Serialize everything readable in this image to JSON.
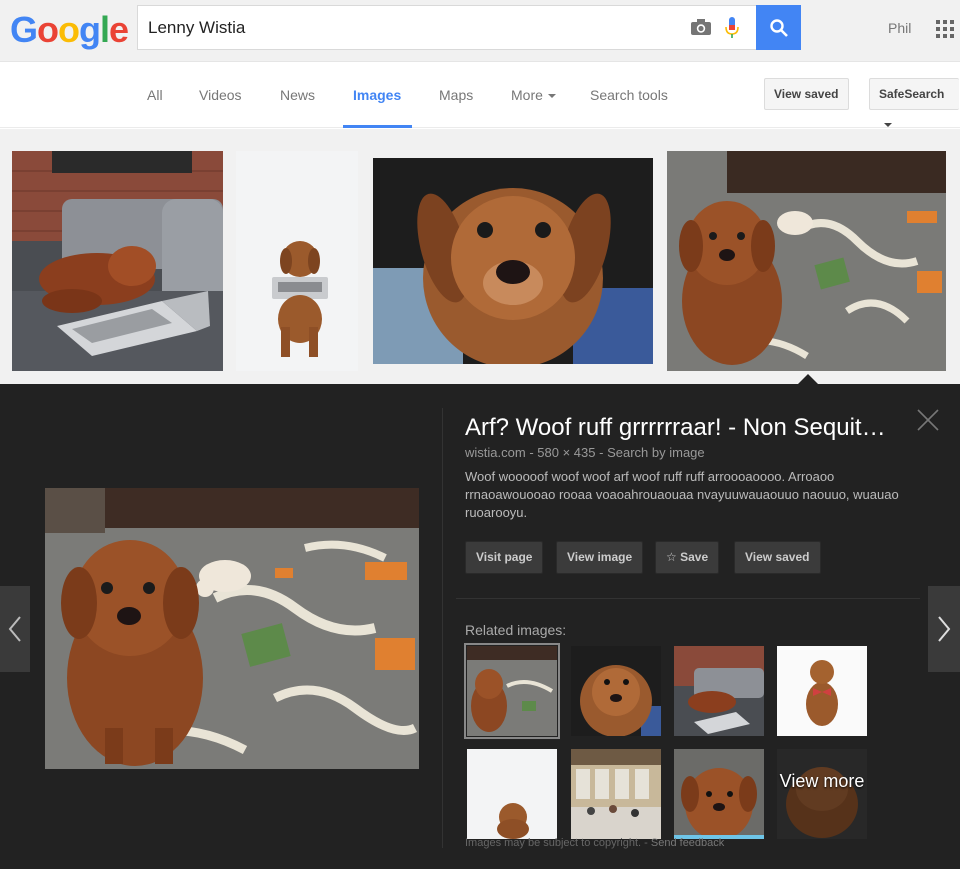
{
  "header": {
    "logo_letters": [
      "G",
      "o",
      "o",
      "g",
      "l",
      "e"
    ],
    "search_value": "Lenny Wistia",
    "user_name": "Phil"
  },
  "tabs": {
    "all": "All",
    "videos": "Videos",
    "news": "News",
    "images": "Images",
    "maps": "Maps",
    "more": "More",
    "search_tools": "Search tools",
    "view_saved": "View saved",
    "safesearch": "SafeSearch",
    "active": "Images"
  },
  "detail": {
    "title": "Arf? Woof ruff grrrrrraar! - Non Sequit…",
    "source": "wistia.com",
    "size": "580 × 435",
    "search_by_image": "Search by image",
    "separator": "-",
    "description": "Woof wooooof woof woof arf woof ruff ruff arroooaoooo. Arroaoo rrnaoawouooao rooaa voaoahrouaouaa nvayuuwauaouuo naouuo, wuauao ruoarooyu.",
    "buttons": {
      "visit": "Visit page",
      "view_image": "View image",
      "save": "Save",
      "view_saved": "View saved"
    },
    "related_label": "Related images:",
    "view_more": "View more",
    "footer_copyright": "Images may be subject to copyright.",
    "footer_feedback": "Send feedback"
  },
  "colors": {
    "google_blue": "#4285f4",
    "panel_bg": "#222222",
    "strip_bg": "#f1f1f1"
  }
}
